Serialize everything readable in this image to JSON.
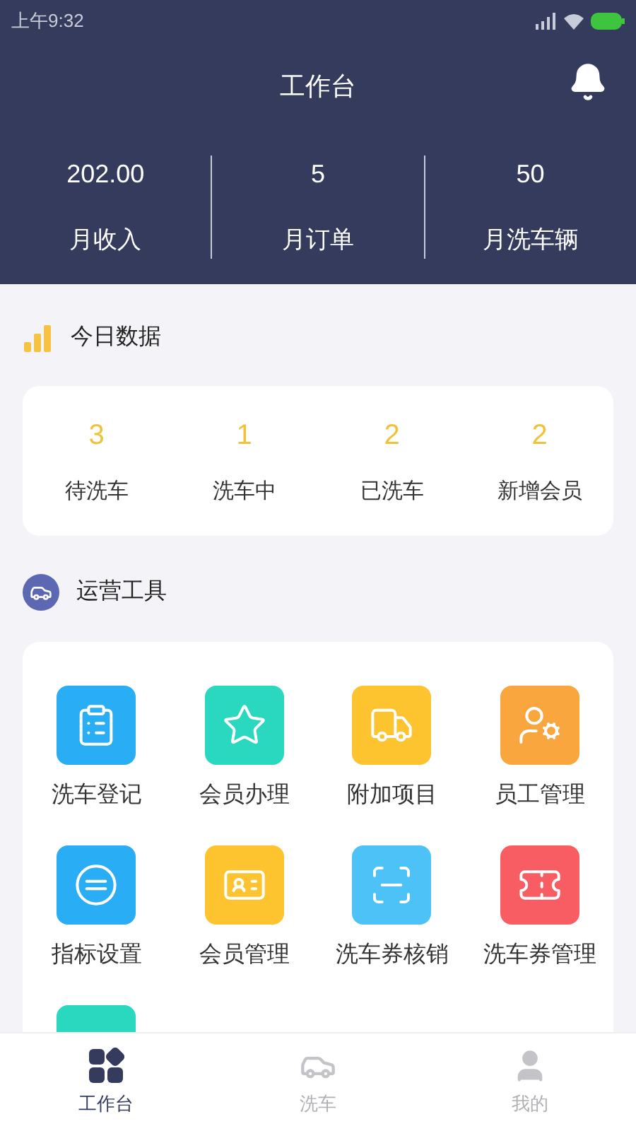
{
  "status_bar": {
    "time": "上午9:32"
  },
  "header": {
    "title": "工作台"
  },
  "month_stats": [
    {
      "value": "202.00",
      "label": "月收入"
    },
    {
      "value": "5",
      "label": "月订单"
    },
    {
      "value": "50",
      "label": "月洗车辆"
    }
  ],
  "today": {
    "title": "今日数据",
    "stats": [
      {
        "value": "3",
        "label": "待洗车"
      },
      {
        "value": "1",
        "label": "洗车中"
      },
      {
        "value": "2",
        "label": "已洗车"
      },
      {
        "value": "2",
        "label": "新增会员"
      }
    ]
  },
  "tools": {
    "title": "运营工具",
    "items": [
      {
        "kind": "register",
        "label": "洗车登记",
        "color": "#29aef5"
      },
      {
        "kind": "member",
        "label": "会员办理",
        "color": "#2ad8c0"
      },
      {
        "kind": "extra",
        "label": "附加项目",
        "color": "#fdc42f"
      },
      {
        "kind": "staff",
        "label": "员工管理",
        "color": "#f9a63f"
      },
      {
        "kind": "metric",
        "label": "指标设置",
        "color": "#29aef5"
      },
      {
        "kind": "vip",
        "label": "会员管理",
        "color": "#fdc42f"
      },
      {
        "kind": "scan",
        "label": "洗车券核销",
        "color": "#4cc2f7"
      },
      {
        "kind": "coupon",
        "label": "洗车券管理",
        "color": "#f75d62"
      },
      {
        "color": "#2ad8c0"
      }
    ]
  },
  "bottom_nav": [
    {
      "kind": "grid",
      "label": "工作台",
      "selected": true
    },
    {
      "kind": "car",
      "label": "洗车",
      "selected": false
    },
    {
      "kind": "user",
      "label": "我的",
      "selected": false
    }
  ]
}
